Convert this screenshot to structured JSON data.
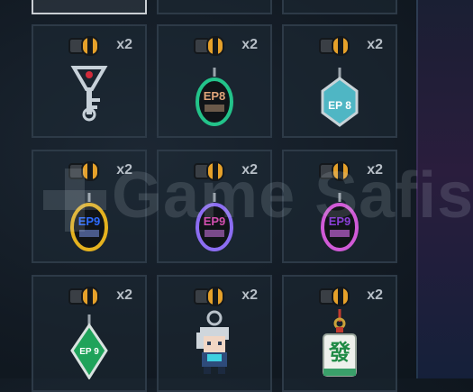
{
  "inventory": {
    "items": [
      {
        "name": "key-charm",
        "qty": "x2",
        "label": ""
      },
      {
        "name": "ep8-green-charm",
        "qty": "x2",
        "label": "EP8"
      },
      {
        "name": "ep8-teal-hex-charm",
        "qty": "x2",
        "label": "EP 8"
      },
      {
        "name": "ep9-yellow-charm",
        "qty": "x2",
        "label": "EP9"
      },
      {
        "name": "ep9-purple-charm",
        "qty": "x2",
        "label": "EP9"
      },
      {
        "name": "ep9-pink-charm",
        "qty": "x2",
        "label": "EP9"
      },
      {
        "name": "ep9-green-diamond-charm",
        "qty": "x2",
        "label": "EP 9"
      },
      {
        "name": "pixel-character-charm",
        "qty": "x2",
        "label": ""
      },
      {
        "name": "mahjong-tile-charm",
        "qty": "x2",
        "label": "發"
      }
    ]
  },
  "watermark": {
    "text": "Game Safis"
  },
  "colors": {
    "slot_border": "#2d3a47",
    "selected_border": "#c9ced3",
    "green_ring": "#23c38a",
    "teal": "#4fb6c4",
    "yellow_ring": "#e5b21f",
    "purple_ring": "#8c6df2",
    "pink_ring": "#d05ad6",
    "green_diamond": "#1fa35a"
  }
}
